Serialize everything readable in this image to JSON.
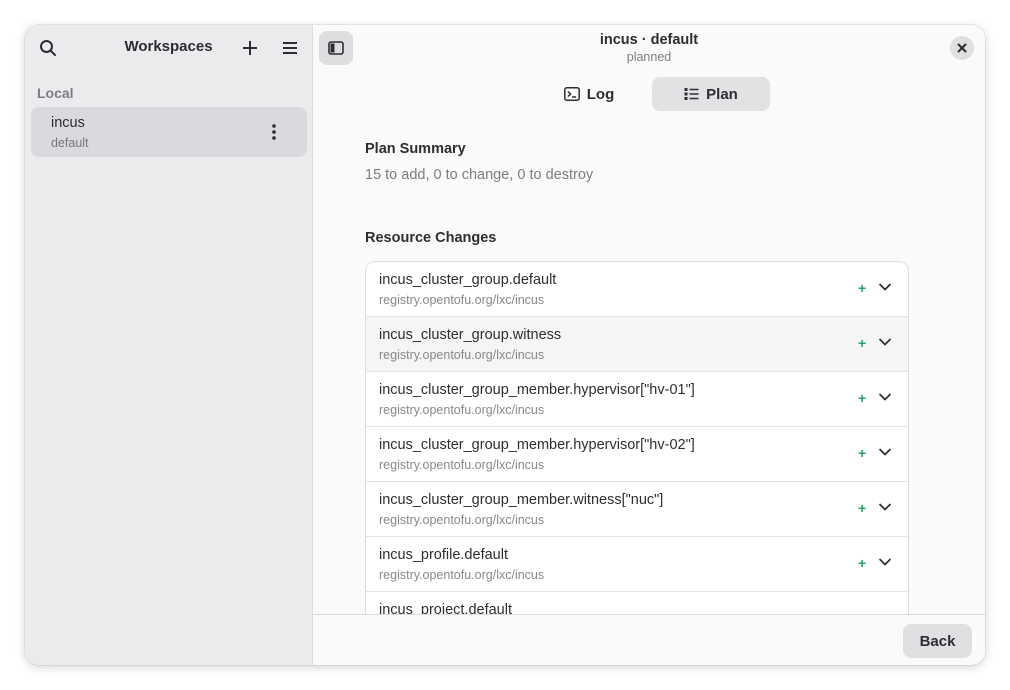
{
  "sidebar": {
    "title": "Workspaces",
    "section_label": "Local",
    "workspace": {
      "name": "incus",
      "subtitle": "default"
    }
  },
  "header": {
    "title": "incus · default",
    "subtitle": "planned"
  },
  "tabs": [
    {
      "label": "Log",
      "icon": "terminal-icon",
      "active": false
    },
    {
      "label": "Plan",
      "icon": "list-icon",
      "active": true
    }
  ],
  "plan": {
    "summary_heading": "Plan Summary",
    "summary_text": "15 to add, 0 to change, 0 to destroy",
    "changes_heading": "Resource Changes",
    "resources": [
      {
        "name": "incus_cluster_group.default",
        "provider": "registry.opentofu.org/lxc/incus",
        "action": "+"
      },
      {
        "name": "incus_cluster_group.witness",
        "provider": "registry.opentofu.org/lxc/incus",
        "action": "+"
      },
      {
        "name": "incus_cluster_group_member.hypervisor[\"hv-01\"]",
        "provider": "registry.opentofu.org/lxc/incus",
        "action": "+"
      },
      {
        "name": "incus_cluster_group_member.hypervisor[\"hv-02\"]",
        "provider": "registry.opentofu.org/lxc/incus",
        "action": "+"
      },
      {
        "name": "incus_cluster_group_member.witness[\"nuc\"]",
        "provider": "registry.opentofu.org/lxc/incus",
        "action": "+"
      },
      {
        "name": "incus_profile.default",
        "provider": "registry.opentofu.org/lxc/incus",
        "action": "+"
      },
      {
        "name": "incus_project.default",
        "provider": "",
        "action": ""
      }
    ]
  },
  "footer": {
    "back_label": "Back"
  },
  "colors": {
    "add": "#26a269",
    "sidebar_bg": "#ebebed",
    "selected_bg": "#dadade"
  }
}
